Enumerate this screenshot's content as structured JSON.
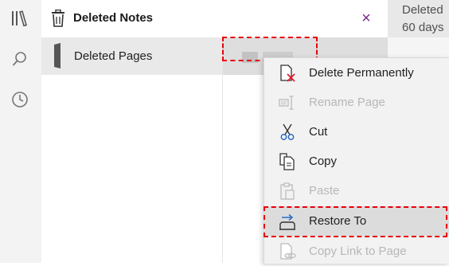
{
  "header": {
    "title": "Deleted Notes",
    "close_symbol": "×"
  },
  "rail": {
    "icons": [
      "notebooks-icon",
      "search-icon",
      "recent-icon"
    ]
  },
  "sections": {
    "items": [
      {
        "label": "Deleted Pages"
      }
    ]
  },
  "preview": {
    "line1": "Deleted",
    "line2": "60 days"
  },
  "context_menu": {
    "items": [
      {
        "label": "Delete Permanently",
        "icon": "delete-permanently-icon",
        "enabled": true
      },
      {
        "label": "Rename Page",
        "icon": "rename-page-icon",
        "enabled": false
      },
      {
        "label": "Cut",
        "icon": "cut-icon",
        "enabled": true
      },
      {
        "label": "Copy",
        "icon": "copy-icon",
        "enabled": true
      },
      {
        "label": "Paste",
        "icon": "paste-icon",
        "enabled": false
      },
      {
        "label": "Restore To",
        "icon": "restore-to-icon",
        "enabled": true,
        "selected": true
      },
      {
        "label": "Copy Link to Page",
        "icon": "copy-link-icon",
        "enabled": false
      }
    ]
  },
  "colors": {
    "accent": "#7d2b8b",
    "highlight": "#e8000b",
    "delete_x": "#e81123",
    "cut_blue": "#2b6cc4"
  }
}
